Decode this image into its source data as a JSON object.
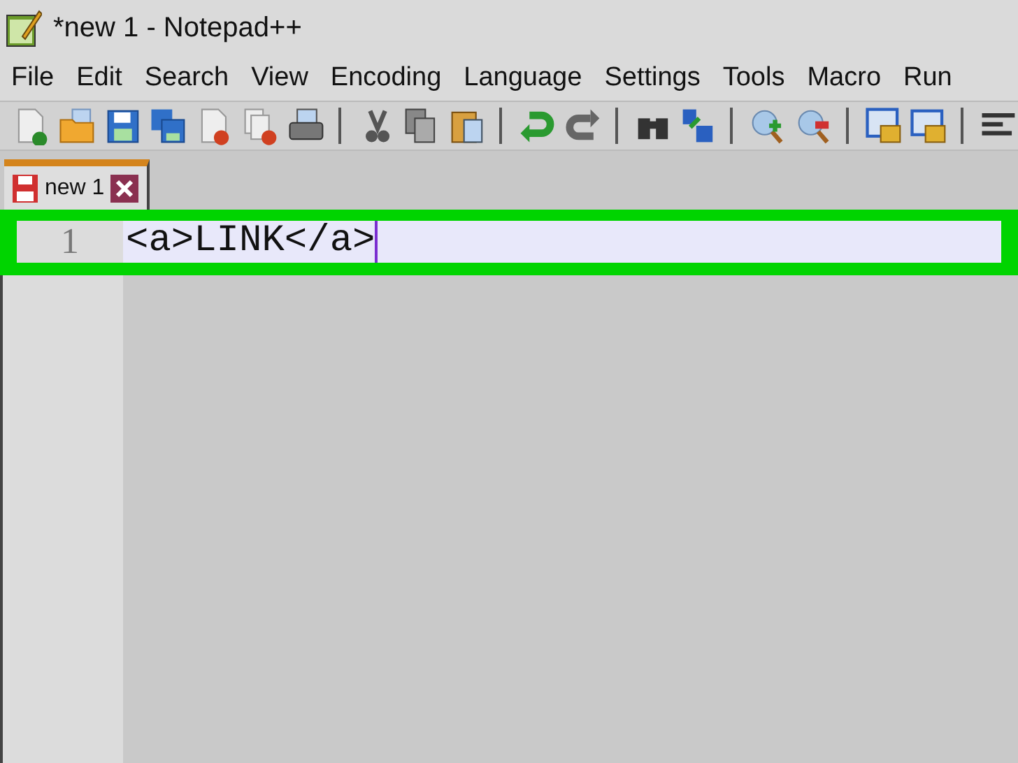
{
  "window": {
    "title": "*new 1 - Notepad++"
  },
  "menu": [
    {
      "label": "File"
    },
    {
      "label": "Edit"
    },
    {
      "label": "Search"
    },
    {
      "label": "View"
    },
    {
      "label": "Encoding"
    },
    {
      "label": "Language"
    },
    {
      "label": "Settings"
    },
    {
      "label": "Tools"
    },
    {
      "label": "Macro"
    },
    {
      "label": "Run"
    }
  ],
  "tabs": [
    {
      "label": "new 1",
      "selected": true,
      "modified": true
    }
  ],
  "editor": {
    "lines": [
      {
        "number": "1",
        "text": "<a>LINK</a>",
        "current": true,
        "highlighted": true
      }
    ]
  }
}
